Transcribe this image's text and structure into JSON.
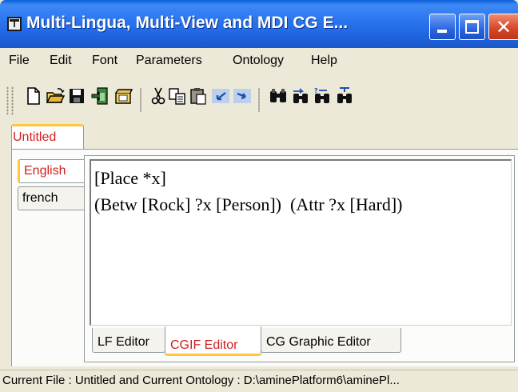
{
  "window": {
    "title": "Multi-Lingua, Multi-View and MDI CG E...",
    "icon": "app-window-icon"
  },
  "menu": [
    "File",
    "Edit",
    "Font",
    "Parameters",
    "Ontology",
    "Help"
  ],
  "toolbar": {
    "icons": [
      "new-file-icon",
      "open-folder-icon",
      "save-icon",
      "exit-icon",
      "open-ontology-icon",
      "cut-icon",
      "copy-icon",
      "paste-icon",
      "undo-icon",
      "redo-icon",
      "find-icon",
      "find-next-icon",
      "find-replace-icon",
      "find-all-icon"
    ]
  },
  "document_tab": "Untitled",
  "language_tabs": [
    "English",
    "french"
  ],
  "editor_text": {
    "line1": "[Place *x]",
    "line2": "(Betw [Rock] ?x [Person])  (Attr ?x [Hard])"
  },
  "editor_tabs": [
    "LF Editor",
    "CGIF Editor",
    "CG Graphic Editor"
  ],
  "status_bar": "Current File : Untitled and Current Ontology : D:\\aminePlatform6\\aminePl...",
  "colors": {
    "title_bar": "#2a74ee",
    "close_button": "#d9492a",
    "active_tab_text": "#d0201e",
    "active_tab_marker": "#ffc83c"
  }
}
